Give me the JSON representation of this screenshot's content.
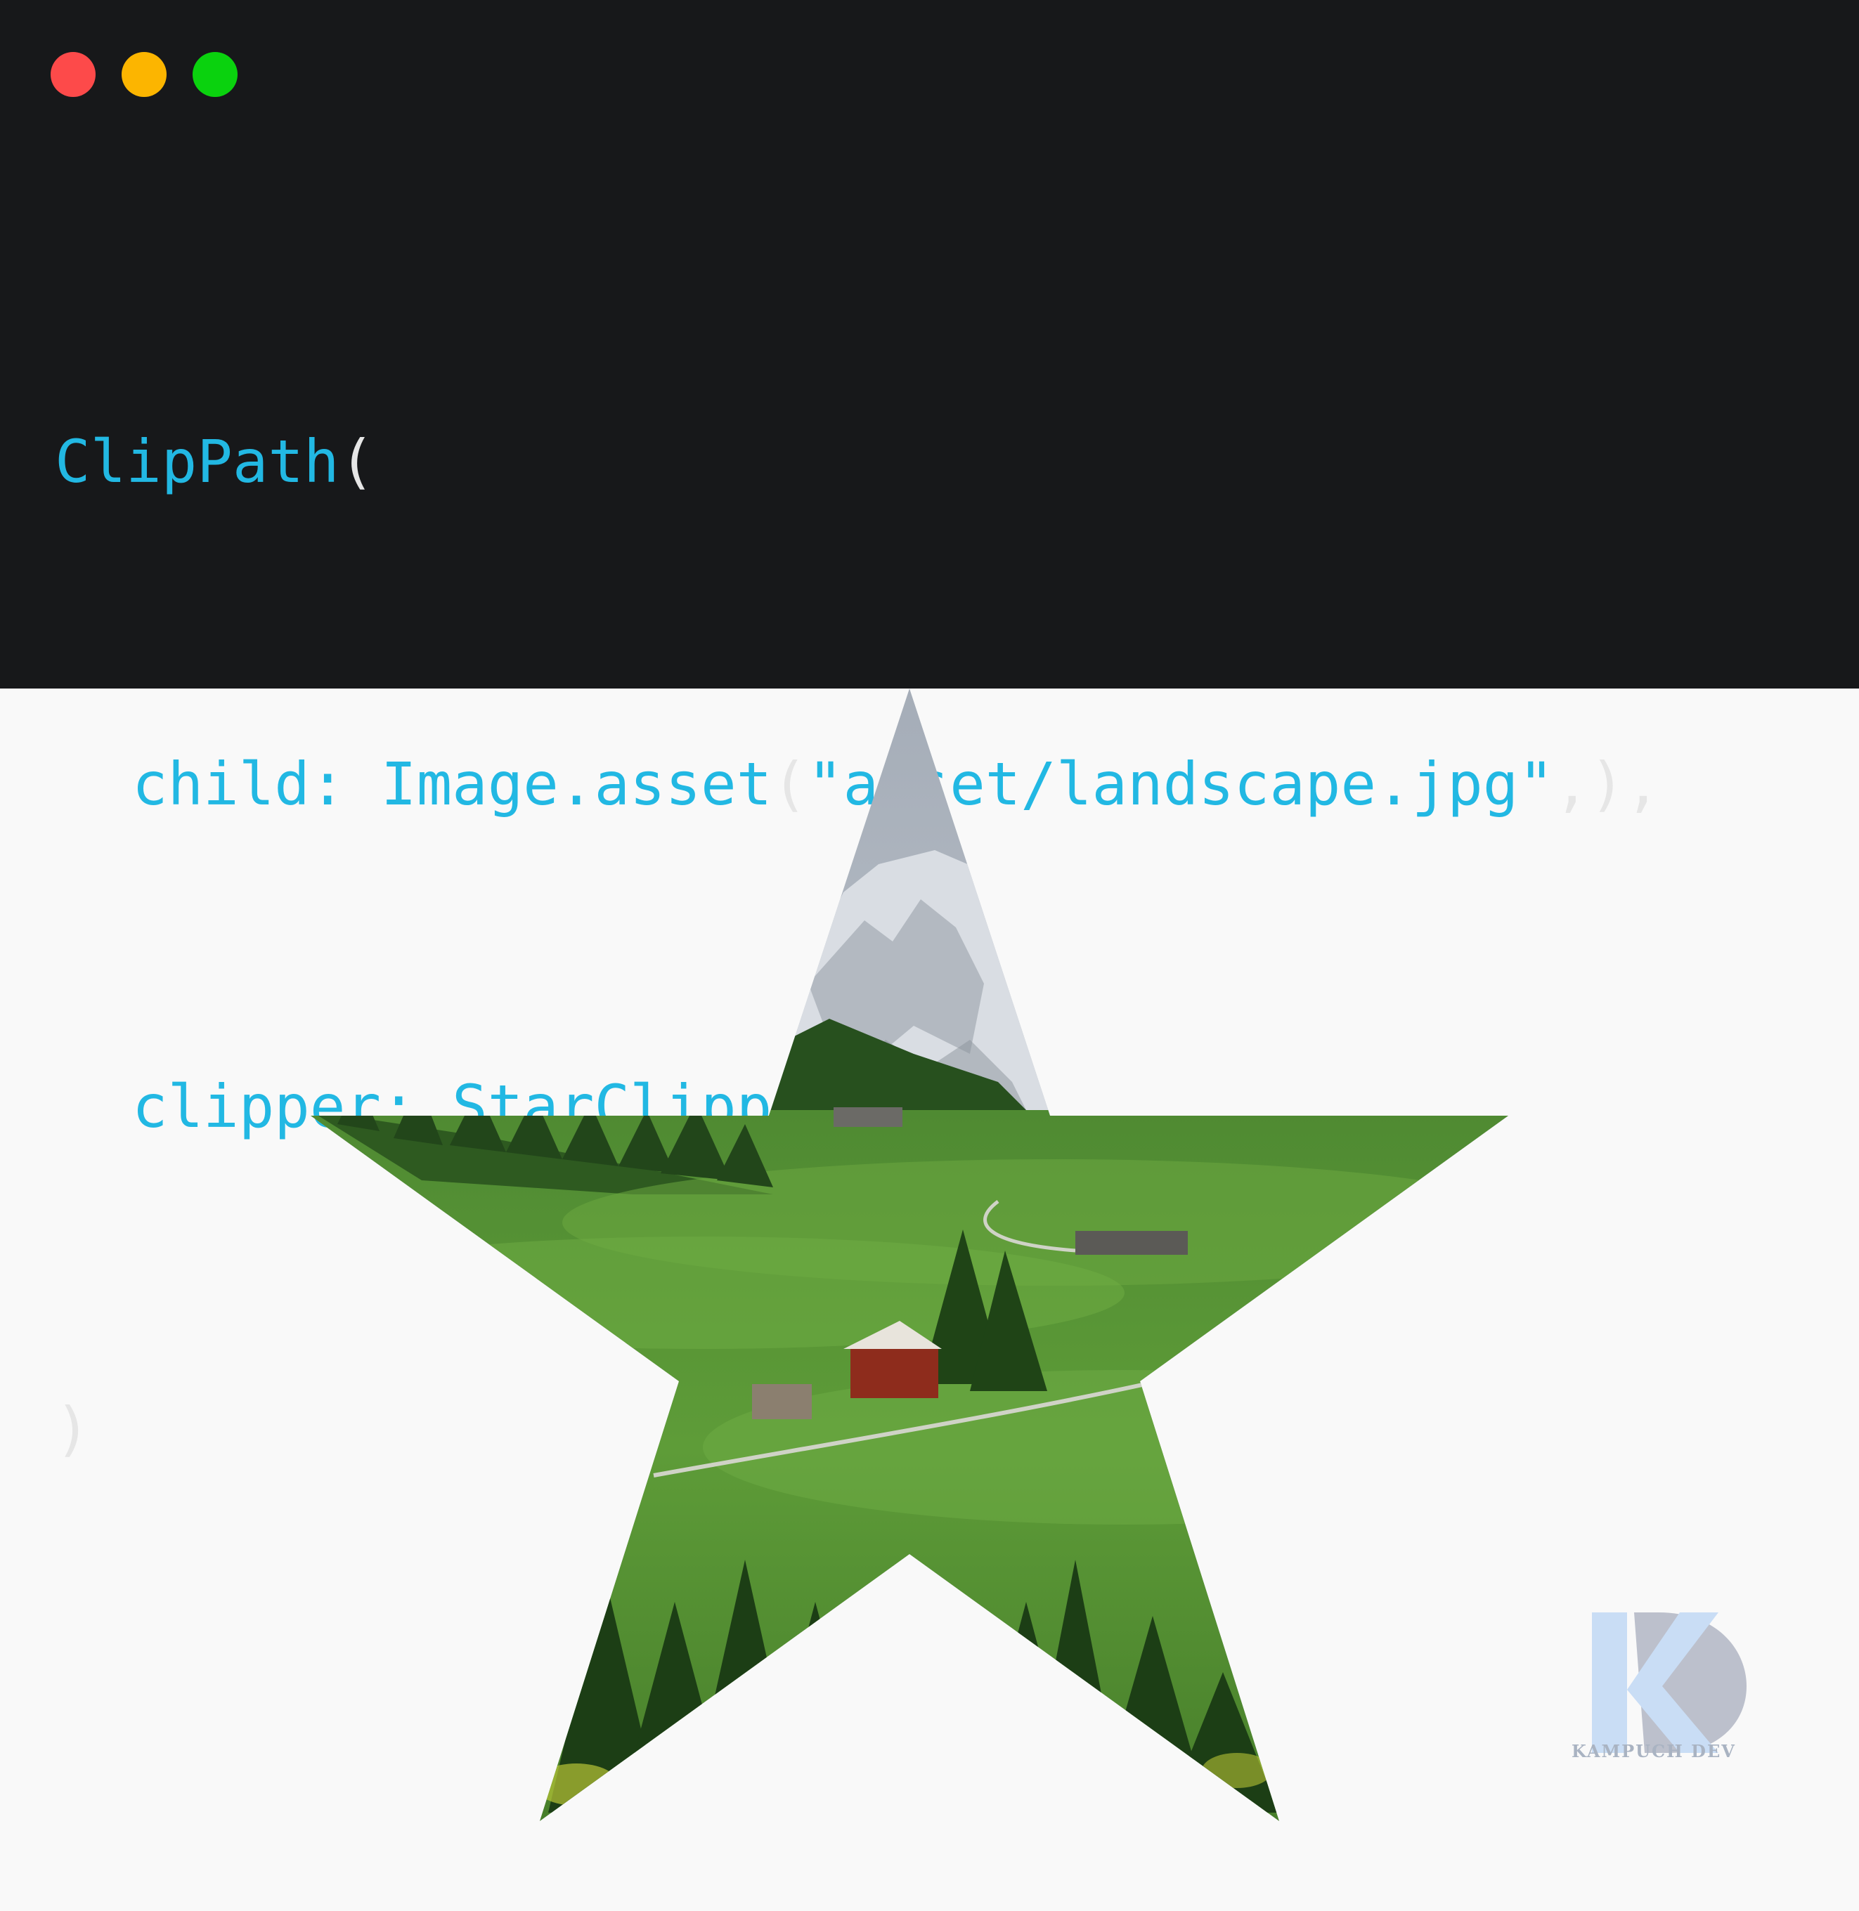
{
  "window": {
    "controls": [
      {
        "name": "close",
        "color": "#fd4a4a"
      },
      {
        "name": "minimize",
        "color": "#fcb500"
      },
      {
        "name": "maximize",
        "color": "#0ad20e"
      }
    ]
  },
  "code": {
    "line1": {
      "name": "ClipPath",
      "open": "("
    },
    "line2": {
      "key": "child:",
      "class": "Image",
      "dot": ".",
      "method": "asset",
      "open": "(",
      "string": "\"asset/landscape.jpg\"",
      "close": ",),"
    },
    "line3": {
      "key": "clipper:",
      "class": "StarClipper",
      "call": "(),"
    },
    "line4": {
      "close": ")"
    }
  },
  "preview": {
    "shape": "star",
    "image": "landscape.jpg"
  },
  "watermark": {
    "text": "KAMPUCH DEV"
  },
  "colors": {
    "code_background": "#17181a",
    "code_token": "#22b8e3",
    "punctuation": "#e6e6e6",
    "canvas": "#f9f9f9"
  }
}
